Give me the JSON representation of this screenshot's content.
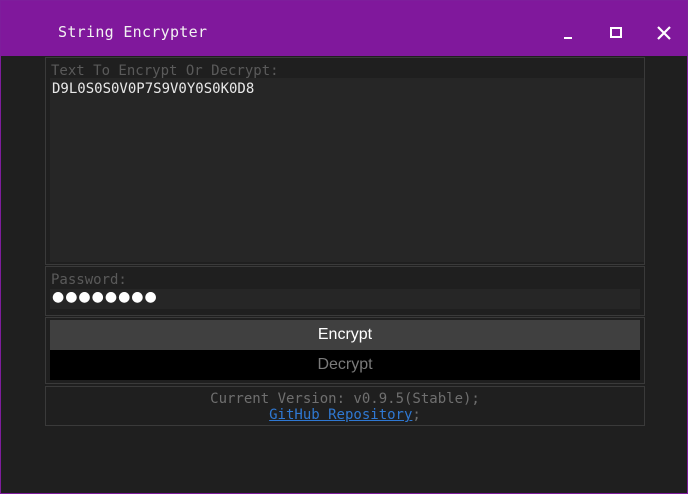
{
  "window": {
    "title": "String Encrypter",
    "accent_color": "#80189c",
    "controls": {
      "minimize_icon": "minimize-icon",
      "maximize_icon": "maximize-icon",
      "close_icon": "close-icon"
    }
  },
  "text_field": {
    "label": "Text To Encrypt Or Decrypt:",
    "value": "D9L0S0S0V0P7S9V0Y0S0K0D8"
  },
  "password_field": {
    "label": "Password:",
    "value": "●●●●●●●●"
  },
  "buttons": {
    "encrypt_label": "Encrypt",
    "decrypt_label": "Decrypt"
  },
  "footer": {
    "version_text": "Current Version: v0.9.5(Stable);",
    "repo_link": "GitHub Repository",
    "repo_suffix": ";"
  }
}
